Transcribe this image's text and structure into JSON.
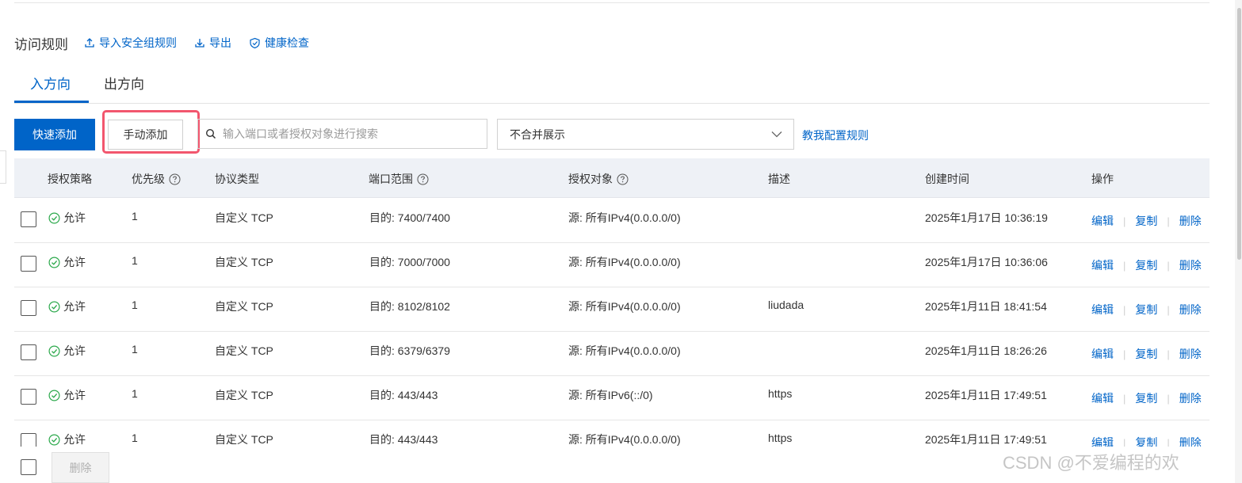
{
  "header": {
    "title": "访问规则",
    "links": [
      {
        "label": "导入安全组规则",
        "icon": "upload-icon"
      },
      {
        "label": "导出",
        "icon": "download-icon"
      },
      {
        "label": "健康检查",
        "icon": "shield-check-icon"
      }
    ]
  },
  "tabs": [
    {
      "label": "入方向",
      "active": true
    },
    {
      "label": "出方向",
      "active": false
    }
  ],
  "toolbar": {
    "quick_add": "快速添加",
    "manual_add": "手动添加",
    "search_placeholder": "输入端口或者授权对象进行搜索",
    "select_value": "不合并展示",
    "help_link": "教我配置规则"
  },
  "table": {
    "columns": [
      "授权策略",
      "优先级",
      "协议类型",
      "端口范围",
      "授权对象",
      "描述",
      "创建时间",
      "操作"
    ],
    "rows": [
      {
        "policy": "允许",
        "priority": "1",
        "protocol": "自定义 TCP",
        "port": "目的: 7400/7400",
        "source": "源: 所有IPv4(0.0.0.0/0)",
        "desc": "",
        "created": "2025年1月17日 10:36:19"
      },
      {
        "policy": "允许",
        "priority": "1",
        "protocol": "自定义 TCP",
        "port": "目的: 7000/7000",
        "source": "源: 所有IPv4(0.0.0.0/0)",
        "desc": "",
        "created": "2025年1月17日 10:36:06"
      },
      {
        "policy": "允许",
        "priority": "1",
        "protocol": "自定义 TCP",
        "port": "目的: 8102/8102",
        "source": "源: 所有IPv4(0.0.0.0/0)",
        "desc": "liudada",
        "created": "2025年1月11日 18:41:54"
      },
      {
        "policy": "允许",
        "priority": "1",
        "protocol": "自定义 TCP",
        "port": "目的: 6379/6379",
        "source": "源: 所有IPv4(0.0.0.0/0)",
        "desc": "",
        "created": "2025年1月11日 18:26:26"
      },
      {
        "policy": "允许",
        "priority": "1",
        "protocol": "自定义 TCP",
        "port": "目的: 443/443",
        "source": "源: 所有IPv6(::/0)",
        "desc": "https",
        "created": "2025年1月11日 17:49:51"
      },
      {
        "policy": "允许",
        "priority": "1",
        "protocol": "自定义 TCP",
        "port": "目的: 443/443",
        "source": "源: 所有IPv4(0.0.0.0/0)",
        "desc": "https",
        "created": "2025年1月11日 17:49:51"
      }
    ],
    "ops": {
      "edit": "编辑",
      "copy": "复制",
      "delete": "删除"
    },
    "separator": "|"
  },
  "footer": {
    "delete_label": "删除"
  },
  "watermark": "CSDN @不爱编程的欢",
  "colors": {
    "primary": "#0064c8",
    "highlight": "#f2566e",
    "success": "#2aa84a",
    "header_bg": "#eef1f6"
  }
}
